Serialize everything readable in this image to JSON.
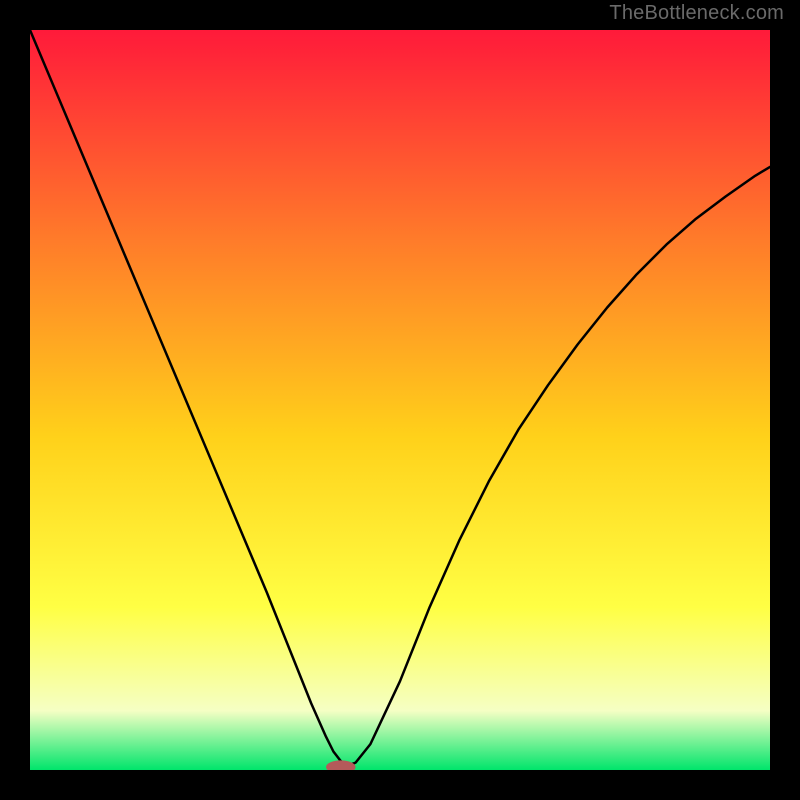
{
  "watermark": "TheBottleneck.com",
  "chart_data": {
    "type": "line",
    "title": "",
    "xlabel": "",
    "ylabel": "",
    "xlim": [
      0,
      100
    ],
    "ylim": [
      0,
      100
    ],
    "grid": false,
    "legend": false,
    "background_gradient": {
      "top": "#ff1a3a",
      "mid_upper": "#ff7a2a",
      "mid": "#ffd11a",
      "mid_lower": "#ffff44",
      "lower_band": "#f5ffc4",
      "bottom": "#00e56b"
    },
    "series": [
      {
        "name": "bottleneck-curve",
        "color": "#000000",
        "x": [
          0,
          4,
          8,
          12,
          16,
          20,
          24,
          28,
          32,
          36,
          38,
          40,
          41,
          42,
          43,
          44,
          46,
          50,
          54,
          58,
          62,
          66,
          70,
          74,
          78,
          82,
          86,
          90,
          94,
          98,
          100
        ],
        "y": [
          100,
          90.5,
          81,
          71.5,
          62,
          52.5,
          43,
          33.5,
          24,
          14,
          9,
          4.5,
          2.5,
          1.2,
          0.6,
          1.0,
          3.5,
          12,
          22,
          31,
          39,
          46,
          52,
          57.5,
          62.5,
          67,
          71,
          74.5,
          77.5,
          80.3,
          81.5
        ]
      }
    ],
    "marker": {
      "name": "minimum-marker",
      "color": "#b45a5a",
      "x": 42,
      "y": 0.4,
      "rx": 2.0,
      "ry": 0.9
    }
  }
}
